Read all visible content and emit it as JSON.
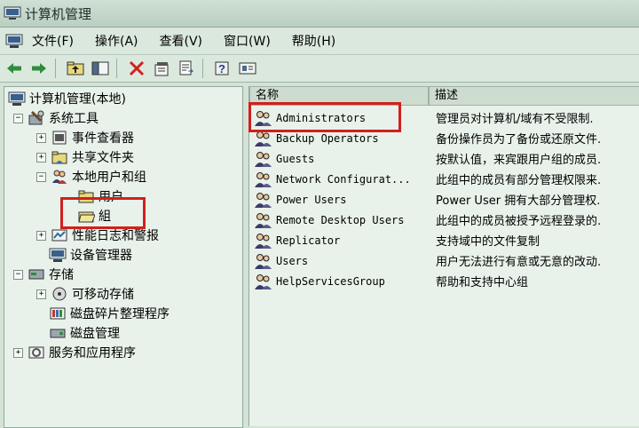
{
  "window": {
    "title": "计算机管理"
  },
  "menu": [
    "文件(F)",
    "操作(A)",
    "查看(V)",
    "窗口(W)",
    "帮助(H)"
  ],
  "toolbar": {
    "buttons": [
      "back-arrow-icon",
      "forward-arrow-icon",
      "up-folder-icon",
      "show-tree-icon",
      "delete-icon",
      "properties-icon",
      "export-icon",
      "help-icon",
      "console-icon"
    ],
    "delete_color": "#d4201e"
  },
  "tree": {
    "root": "计算机管理(本地)",
    "system_tools": "系统工具",
    "event_viewer": "事件查看器",
    "shared_folders": "共享文件夹",
    "local_users_groups": "本地用户和组",
    "users": "用户",
    "groups": "組",
    "perf_logs": "性能日志和警报",
    "device_manager": "设备管理器",
    "storage": "存储",
    "removable_storage": "可移动存储",
    "disk_defrag": "磁盘碎片整理程序",
    "disk_management": "磁盘管理",
    "services_apps": "服务和应用程序"
  },
  "list": {
    "columns": [
      "名称",
      "描述"
    ],
    "rows": [
      {
        "name": "Administrators",
        "desc": "管理员对计算机/域有不受限制."
      },
      {
        "name": "Backup Operators",
        "desc": "备份操作员为了备份或还原文件."
      },
      {
        "name": "Guests",
        "desc": "按默认值，来宾跟用户组的成员."
      },
      {
        "name": "Network Configurat...",
        "desc": "此组中的成员有部分管理权限来."
      },
      {
        "name": "Power Users",
        "desc": "Power User 拥有大部分管理权."
      },
      {
        "name": "Remote Desktop Users",
        "desc": "此组中的成员被授予远程登录的."
      },
      {
        "name": "Replicator",
        "desc": "支持域中的文件复制"
      },
      {
        "name": "Users",
        "desc": "用户无法进行有意或无意的改动."
      },
      {
        "name": "HelpServicesGroup",
        "desc": "帮助和支持中心组"
      }
    ]
  },
  "colors": {
    "highlight_box": "#d0201e",
    "background": "#d4e3d6"
  }
}
